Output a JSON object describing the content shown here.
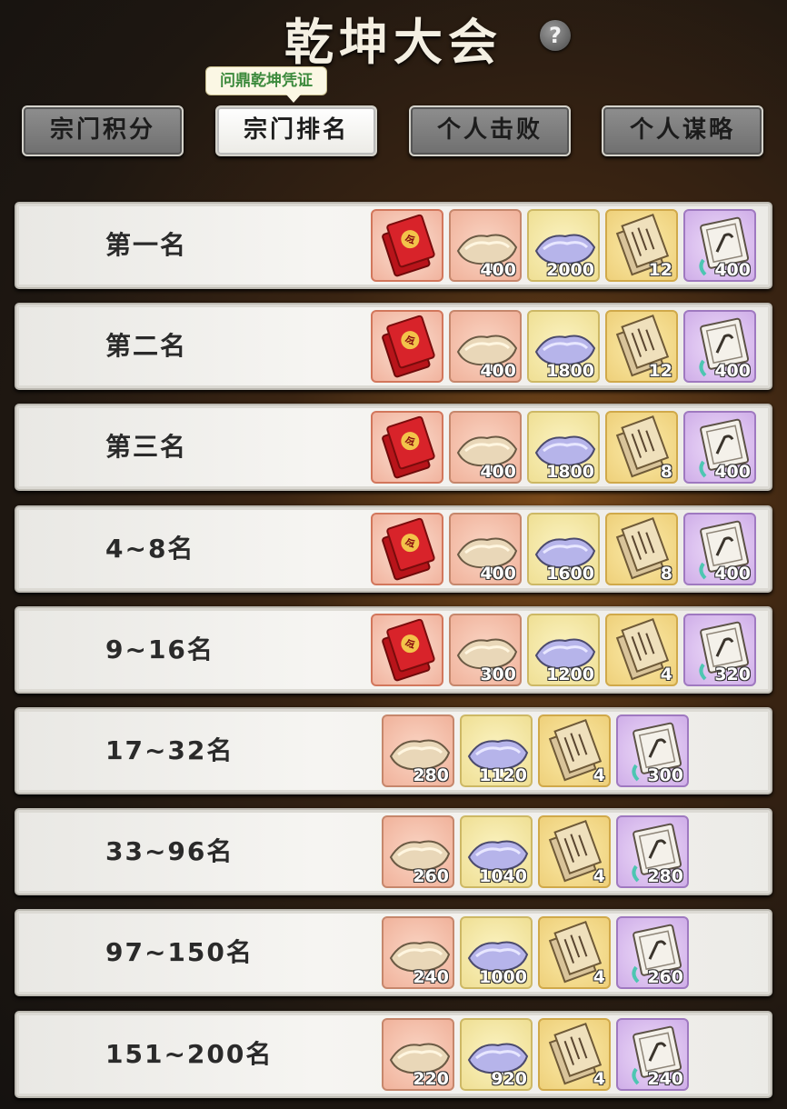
{
  "title": "乾坤大会",
  "help_label": "?",
  "tooltip": "问鼎乾坤凭证",
  "tabs": [
    "宗门积分",
    "宗门排名",
    "个人击败",
    "个人谋略"
  ],
  "active_tab": 1,
  "rows": [
    {
      "rank": "第一名",
      "items": [
        {
          "icon": "red-envelope-icon",
          "bg": "red",
          "qty": ""
        },
        {
          "icon": "gold-ingot-icon",
          "bg": "orange",
          "qty": "400"
        },
        {
          "icon": "silver-ingot-icon",
          "bg": "yellow",
          "qty": "2000"
        },
        {
          "icon": "scroll-icon",
          "bg": "gold",
          "qty": "12"
        },
        {
          "icon": "skill-book-icon",
          "bg": "purple",
          "qty": "400"
        }
      ]
    },
    {
      "rank": "第二名",
      "items": [
        {
          "icon": "red-envelope-icon",
          "bg": "red",
          "qty": ""
        },
        {
          "icon": "gold-ingot-icon",
          "bg": "orange",
          "qty": "400"
        },
        {
          "icon": "silver-ingot-icon",
          "bg": "yellow",
          "qty": "1800"
        },
        {
          "icon": "scroll-icon",
          "bg": "gold",
          "qty": "12"
        },
        {
          "icon": "skill-book-icon",
          "bg": "purple",
          "qty": "400"
        }
      ]
    },
    {
      "rank": "第三名",
      "items": [
        {
          "icon": "red-envelope-icon",
          "bg": "red",
          "qty": ""
        },
        {
          "icon": "gold-ingot-icon",
          "bg": "orange",
          "qty": "400"
        },
        {
          "icon": "silver-ingot-icon",
          "bg": "yellow",
          "qty": "1800"
        },
        {
          "icon": "scroll-icon",
          "bg": "gold",
          "qty": "8"
        },
        {
          "icon": "skill-book-icon",
          "bg": "purple",
          "qty": "400"
        }
      ]
    },
    {
      "rank": "4~8名",
      "items": [
        {
          "icon": "red-envelope-icon",
          "bg": "red",
          "qty": ""
        },
        {
          "icon": "gold-ingot-icon",
          "bg": "orange",
          "qty": "400"
        },
        {
          "icon": "silver-ingot-icon",
          "bg": "yellow",
          "qty": "1600"
        },
        {
          "icon": "scroll-icon",
          "bg": "gold",
          "qty": "8"
        },
        {
          "icon": "skill-book-icon",
          "bg": "purple",
          "qty": "400"
        }
      ]
    },
    {
      "rank": "9~16名",
      "items": [
        {
          "icon": "red-envelope-icon",
          "bg": "red",
          "qty": ""
        },
        {
          "icon": "gold-ingot-icon",
          "bg": "orange",
          "qty": "300"
        },
        {
          "icon": "silver-ingot-icon",
          "bg": "yellow",
          "qty": "1200"
        },
        {
          "icon": "scroll-icon",
          "bg": "gold",
          "qty": "4"
        },
        {
          "icon": "skill-book-icon",
          "bg": "purple",
          "qty": "320"
        }
      ]
    },
    {
      "rank": "17~32名",
      "items": [
        {
          "icon": "gold-ingot-icon",
          "bg": "orange",
          "qty": "280"
        },
        {
          "icon": "silver-ingot-icon",
          "bg": "yellow",
          "qty": "1120"
        },
        {
          "icon": "scroll-icon",
          "bg": "gold",
          "qty": "4"
        },
        {
          "icon": "skill-book-icon",
          "bg": "purple",
          "qty": "300"
        }
      ]
    },
    {
      "rank": "33~96名",
      "items": [
        {
          "icon": "gold-ingot-icon",
          "bg": "orange",
          "qty": "260"
        },
        {
          "icon": "silver-ingot-icon",
          "bg": "yellow",
          "qty": "1040"
        },
        {
          "icon": "scroll-icon",
          "bg": "gold",
          "qty": "4"
        },
        {
          "icon": "skill-book-icon",
          "bg": "purple",
          "qty": "280"
        }
      ]
    },
    {
      "rank": "97~150名",
      "items": [
        {
          "icon": "gold-ingot-icon",
          "bg": "orange",
          "qty": "240"
        },
        {
          "icon": "silver-ingot-icon",
          "bg": "yellow",
          "qty": "1000"
        },
        {
          "icon": "scroll-icon",
          "bg": "gold",
          "qty": "4"
        },
        {
          "icon": "skill-book-icon",
          "bg": "purple",
          "qty": "260"
        }
      ]
    },
    {
      "rank": "151~200名",
      "items": [
        {
          "icon": "gold-ingot-icon",
          "bg": "orange",
          "qty": "220"
        },
        {
          "icon": "silver-ingot-icon",
          "bg": "yellow",
          "qty": "920"
        },
        {
          "icon": "scroll-icon",
          "bg": "gold",
          "qty": "4"
        },
        {
          "icon": "skill-book-icon",
          "bg": "purple",
          "qty": "240"
        }
      ]
    }
  ]
}
